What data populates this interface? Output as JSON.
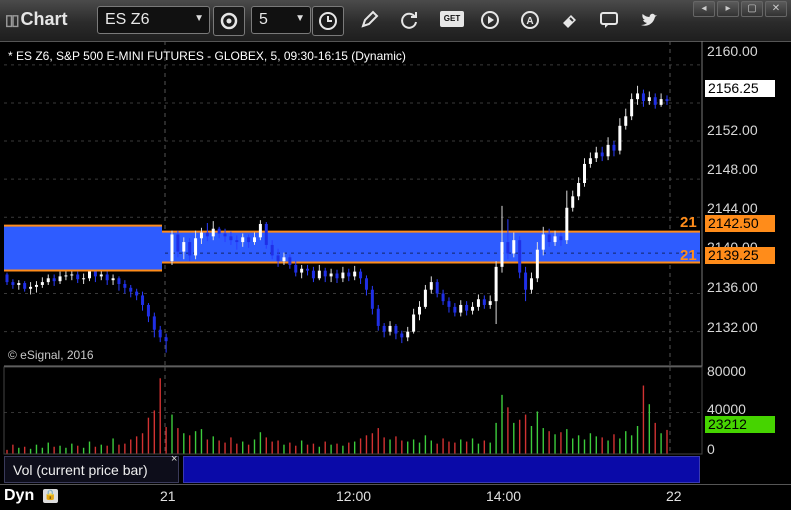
{
  "window": {
    "title": "Chart",
    "symbol": "ES Z6",
    "interval": "5",
    "controls": [
      "◂",
      "▸",
      "▢",
      "✕"
    ]
  },
  "toolbar": {
    "icons": [
      "crosshair-settings-icon",
      "clock-icon",
      "pencil-icon",
      "refresh-icon",
      "get-icon",
      "play-icon",
      "alert-icon",
      "erase-icon",
      "comment-icon",
      "twitter-icon"
    ],
    "get_label": "GET"
  },
  "chart": {
    "title": "* ES Z6, S&P 500 E-MINI FUTURES - GLOBEX, 5, 09:30-16:15 (Dynamic)",
    "copyright": "© eSignal, 2016",
    "band_color": "#2e5cff",
    "band_border": "#ff8c1a",
    "up_color": "#ffffff",
    "down_color": "#1f2fe6"
  },
  "price_axis": {
    "ticks": [
      "2160.00",
      "2152.00",
      "2148.00",
      "2144.00",
      "2140.00",
      "2136.00",
      "2132.00"
    ],
    "last_price": "2156.25",
    "level_upper": "2142.50",
    "level_lower": "2139.25",
    "level_upper_side": "21",
    "level_lower_side": "21"
  },
  "volume_axis": {
    "ticks": [
      "80000",
      "40000",
      "0"
    ],
    "current_volume": "23212",
    "legend": "Vol (current price bar)",
    "close_glyph": "×"
  },
  "time_axis": {
    "labels": [
      "21",
      "12:00",
      "14:00",
      "22"
    ],
    "mode": "Dyn"
  },
  "chart_data": {
    "type": "candlestick",
    "price_range": [
      2128.5,
      2162.5
    ],
    "volume_range": [
      0,
      80000
    ],
    "candles": [
      [
        2138.0,
        2137.2,
        2138.2,
        2136.9
      ],
      [
        2137.2,
        2136.9,
        2137.5,
        2136.5
      ],
      [
        2136.9,
        2137.1,
        2137.4,
        2136.4
      ],
      [
        2137.1,
        2136.5,
        2137.3,
        2136.2
      ],
      [
        2136.5,
        2136.7,
        2137.2,
        2135.9
      ],
      [
        2136.7,
        2136.9,
        2137.3,
        2136.1
      ],
      [
        2136.9,
        2137.2,
        2137.7,
        2136.6
      ],
      [
        2137.2,
        2137.6,
        2138.0,
        2136.9
      ],
      [
        2137.6,
        2137.3,
        2138.0,
        2136.8
      ],
      [
        2137.3,
        2137.8,
        2138.3,
        2137.0
      ],
      [
        2137.8,
        2137.9,
        2138.4,
        2137.4
      ],
      [
        2137.9,
        2138.0,
        2138.5,
        2137.4
      ],
      [
        2138.0,
        2137.5,
        2138.3,
        2137.1
      ],
      [
        2137.5,
        2137.6,
        2138.1,
        2137.0
      ],
      [
        2137.6,
        2138.4,
        2138.9,
        2137.3
      ],
      [
        2138.4,
        2137.8,
        2138.7,
        2137.2
      ],
      [
        2137.8,
        2138.0,
        2138.5,
        2137.4
      ],
      [
        2138.0,
        2137.4,
        2138.4,
        2136.9
      ],
      [
        2137.4,
        2137.6,
        2138.0,
        2136.9
      ],
      [
        2137.6,
        2137.0,
        2137.8,
        2136.3
      ],
      [
        2137.0,
        2136.6,
        2137.4,
        2136.0
      ],
      [
        2136.6,
        2136.2,
        2136.9,
        2135.6
      ],
      [
        2136.2,
        2135.8,
        2136.5,
        2135.3
      ],
      [
        2135.8,
        2134.8,
        2136.2,
        2134.2
      ],
      [
        2134.8,
        2133.6,
        2135.0,
        2133.0
      ],
      [
        2133.6,
        2132.2,
        2134.0,
        2131.4
      ],
      [
        2132.2,
        2131.4,
        2132.6,
        2130.9
      ],
      [
        2131.4,
        2131.0,
        2131.8,
        2129.8
      ],
      [
        2139.4,
        2142.2,
        2142.6,
        2139.0
      ],
      [
        2142.2,
        2140.4,
        2142.6,
        2139.8
      ],
      [
        2140.4,
        2141.4,
        2141.9,
        2139.6
      ],
      [
        2141.4,
        2140.0,
        2141.8,
        2139.4
      ],
      [
        2140.0,
        2141.8,
        2142.6,
        2139.6
      ],
      [
        2141.8,
        2142.4,
        2142.9,
        2141.2
      ],
      [
        2142.4,
        2142.0,
        2143.4,
        2141.5
      ],
      [
        2142.0,
        2142.8,
        2143.6,
        2141.6
      ],
      [
        2142.8,
        2142.3,
        2143.0,
        2141.8
      ],
      [
        2142.3,
        2142.0,
        2142.8,
        2141.4
      ],
      [
        2142.0,
        2141.6,
        2142.5,
        2141.1
      ],
      [
        2141.6,
        2141.4,
        2142.1,
        2140.6
      ],
      [
        2141.4,
        2141.9,
        2142.3,
        2140.9
      ],
      [
        2141.9,
        2141.4,
        2142.2,
        2140.8
      ],
      [
        2141.4,
        2141.9,
        2142.4,
        2141.1
      ],
      [
        2141.9,
        2143.3,
        2143.7,
        2141.6
      ],
      [
        2143.3,
        2141.1,
        2143.5,
        2140.7
      ],
      [
        2141.1,
        2140.0,
        2141.6,
        2139.6
      ],
      [
        2140.0,
        2139.4,
        2140.7,
        2138.8
      ],
      [
        2139.4,
        2139.8,
        2140.3,
        2139.0
      ],
      [
        2139.8,
        2139.0,
        2140.1,
        2138.6
      ],
      [
        2139.0,
        2138.2,
        2139.4,
        2137.8
      ],
      [
        2138.2,
        2138.6,
        2139.0,
        2137.6
      ],
      [
        2138.6,
        2138.4,
        2139.0,
        2137.9
      ],
      [
        2138.4,
        2137.6,
        2138.8,
        2137.2
      ],
      [
        2137.6,
        2138.4,
        2139.0,
        2137.4
      ],
      [
        2138.4,
        2137.8,
        2138.7,
        2137.2
      ],
      [
        2137.8,
        2138.1,
        2138.6,
        2137.2
      ],
      [
        2138.1,
        2137.6,
        2138.5,
        2137.1
      ],
      [
        2137.6,
        2138.2,
        2138.8,
        2137.2
      ],
      [
        2138.2,
        2137.8,
        2138.6,
        2137.3
      ],
      [
        2137.8,
        2138.3,
        2138.9,
        2137.4
      ],
      [
        2138.3,
        2137.6,
        2138.6,
        2137.0
      ],
      [
        2137.6,
        2136.4,
        2137.9,
        2135.8
      ],
      [
        2136.4,
        2134.4,
        2136.8,
        2133.8
      ],
      [
        2134.4,
        2132.6,
        2134.8,
        2132.1
      ],
      [
        2132.6,
        2132.0,
        2132.9,
        2131.4
      ],
      [
        2132.0,
        2132.6,
        2133.1,
        2131.6
      ],
      [
        2132.6,
        2131.8,
        2132.8,
        2131.2
      ],
      [
        2131.8,
        2131.4,
        2132.1,
        2130.8
      ],
      [
        2131.4,
        2132.0,
        2132.5,
        2131.0
      ],
      [
        2132.0,
        2133.8,
        2134.4,
        2131.8
      ],
      [
        2133.8,
        2134.6,
        2135.2,
        2133.2
      ],
      [
        2134.6,
        2136.4,
        2136.9,
        2134.4
      ],
      [
        2136.4,
        2137.2,
        2137.8,
        2136.0
      ],
      [
        2137.2,
        2136.0,
        2137.5,
        2135.6
      ],
      [
        2136.0,
        2135.2,
        2136.4,
        2134.8
      ],
      [
        2135.2,
        2134.6,
        2135.6,
        2134.0
      ],
      [
        2134.6,
        2134.0,
        2135.0,
        2133.6
      ],
      [
        2134.0,
        2134.8,
        2135.3,
        2133.6
      ],
      [
        2134.8,
        2134.2,
        2135.2,
        2133.7
      ],
      [
        2134.2,
        2134.6,
        2135.1,
        2133.8
      ],
      [
        2134.6,
        2135.4,
        2135.9,
        2134.2
      ],
      [
        2135.4,
        2134.8,
        2135.8,
        2134.4
      ],
      [
        2134.8,
        2135.2,
        2135.8,
        2134.4
      ],
      [
        2135.2,
        2138.8,
        2139.4,
        2132.8
      ],
      [
        2138.8,
        2141.4,
        2145.2,
        2138.2
      ],
      [
        2141.4,
        2140.2,
        2143.8,
        2139.6
      ],
      [
        2140.2,
        2141.6,
        2142.4,
        2139.8
      ],
      [
        2141.6,
        2138.2,
        2142.0,
        2137.6
      ],
      [
        2138.2,
        2136.4,
        2138.8,
        2135.2
      ],
      [
        2136.4,
        2137.6,
        2138.2,
        2136.0
      ],
      [
        2137.6,
        2140.6,
        2141.4,
        2137.2
      ],
      [
        2140.6,
        2142.2,
        2143.0,
        2140.0
      ],
      [
        2142.2,
        2141.4,
        2142.8,
        2140.9
      ],
      [
        2141.4,
        2142.0,
        2142.6,
        2141.0
      ],
      [
        2142.0,
        2141.6,
        2142.4,
        2141.0
      ],
      [
        2141.6,
        2145.0,
        2146.8,
        2141.2
      ],
      [
        2145.0,
        2146.2,
        2146.8,
        2144.6
      ],
      [
        2146.2,
        2147.6,
        2148.2,
        2145.8
      ],
      [
        2147.6,
        2149.6,
        2150.2,
        2147.2
      ],
      [
        2149.6,
        2150.2,
        2150.8,
        2149.2
      ],
      [
        2150.2,
        2150.8,
        2151.4,
        2149.8
      ],
      [
        2150.8,
        2150.4,
        2151.4,
        2149.9
      ],
      [
        2150.4,
        2151.6,
        2152.4,
        2150.0
      ],
      [
        2151.6,
        2151.0,
        2152.0,
        2150.4
      ],
      [
        2151.0,
        2153.6,
        2154.4,
        2150.6
      ],
      [
        2153.6,
        2154.6,
        2155.4,
        2153.2
      ],
      [
        2154.6,
        2156.4,
        2157.0,
        2154.2
      ],
      [
        2156.4,
        2157.0,
        2157.8,
        2155.8
      ],
      [
        2157.0,
        2156.2,
        2157.4,
        2155.6
      ],
      [
        2156.2,
        2156.6,
        2157.2,
        2155.8
      ],
      [
        2156.6,
        2155.8,
        2157.0,
        2155.4
      ],
      [
        2155.8,
        2156.4,
        2157.0,
        2155.6
      ],
      [
        2156.4,
        2156.2,
        2156.8,
        2155.8
      ]
    ],
    "volumes": [
      4000,
      9000,
      6000,
      7000,
      5000,
      9000,
      6000,
      11000,
      7000,
      8000,
      6000,
      10000,
      8000,
      6000,
      12000,
      7000,
      9000,
      8000,
      15000,
      9000,
      10000,
      14000,
      17000,
      20000,
      35000,
      42000,
      73000,
      26000,
      38000,
      25000,
      20000,
      18000,
      22000,
      24000,
      14000,
      17000,
      13000,
      11000,
      16000,
      10000,
      12000,
      9000,
      14000,
      21000,
      16000,
      12000,
      13000,
      9000,
      11000,
      8000,
      13000,
      9000,
      10000,
      7000,
      12000,
      9000,
      10000,
      8000,
      11000,
      12000,
      15000,
      18000,
      20000,
      25000,
      16000,
      14000,
      17000,
      13000,
      12000,
      14000,
      11000,
      18000,
      13000,
      10000,
      15000,
      12000,
      11000,
      14000,
      12000,
      15000,
      10000,
      13000,
      11000,
      30000,
      57000,
      45000,
      30000,
      33000,
      38000,
      27000,
      41000,
      25000,
      22000,
      19000,
      21000,
      24000,
      15000,
      18000,
      14000,
      20000,
      17000,
      16000,
      13000,
      19000,
      15000,
      22000,
      18000,
      27000,
      66000,
      48000,
      30000,
      20000,
      23212
    ]
  }
}
